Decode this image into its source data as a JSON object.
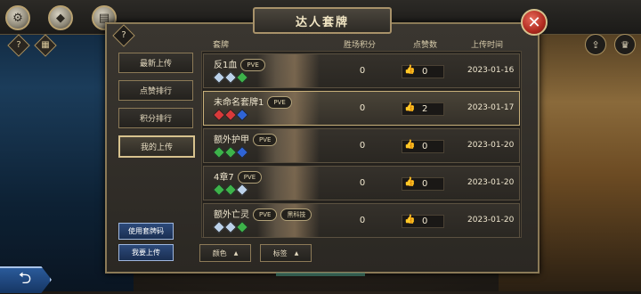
{
  "title": "达人套牌",
  "close_glyph": "✕",
  "help_glyph": "?",
  "sidebar": {
    "tabs": [
      {
        "label": "最新上传",
        "active": false
      },
      {
        "label": "点赞排行",
        "active": false
      },
      {
        "label": "积分排行",
        "active": false
      },
      {
        "label": "我的上传",
        "active": true
      }
    ],
    "use_code_label": "使用套牌码",
    "upload_label": "我要上传"
  },
  "table": {
    "columns": [
      "套牌",
      "胜场积分",
      "点赞数",
      "上传时间"
    ],
    "rows": [
      {
        "name": "反1血",
        "tags": [
          "PVE"
        ],
        "gems": [
          "#bcd2ea",
          "#bcd2ea",
          "#3db34a"
        ],
        "score": "0",
        "likes": "0",
        "liked": false,
        "date": "2023-01-16",
        "selected": false
      },
      {
        "name": "未命名套牌1",
        "tags": [
          "PVE"
        ],
        "gems": [
          "#d93a3a",
          "#d93a3a",
          "#2f64d6"
        ],
        "score": "0",
        "likes": "2",
        "liked": true,
        "date": "2023-01-17",
        "selected": true
      },
      {
        "name": "额外护甲",
        "tags": [
          "PVE"
        ],
        "gems": [
          "#3db34a",
          "#3db34a",
          "#2f64d6"
        ],
        "score": "0",
        "likes": "0",
        "liked": false,
        "date": "2023-01-20",
        "selected": false
      },
      {
        "name": "4章7",
        "tags": [
          "PVE"
        ],
        "gems": [
          "#3db34a",
          "#3db34a",
          "#bcd2ea"
        ],
        "score": "0",
        "likes": "0",
        "liked": false,
        "date": "2023-01-20",
        "selected": false
      },
      {
        "name": "额外亡灵",
        "tags": [
          "PVE",
          "黑科技"
        ],
        "gems": [
          "#bcd2ea",
          "#bcd2ea",
          "#3db34a"
        ],
        "score": "0",
        "likes": "0",
        "liked": false,
        "date": "2023-01-20",
        "selected": false
      }
    ]
  },
  "filters": {
    "color_label": "颜色",
    "tag_label": "标签",
    "caret": "▲"
  },
  "topbar_icons": [
    "settings-icon",
    "handshake-icon",
    "cards-icon"
  ],
  "top_right_icons": [
    "share-icon",
    "trophy-icon"
  ],
  "like_glyph": "👍",
  "back_glyph": "⮌"
}
